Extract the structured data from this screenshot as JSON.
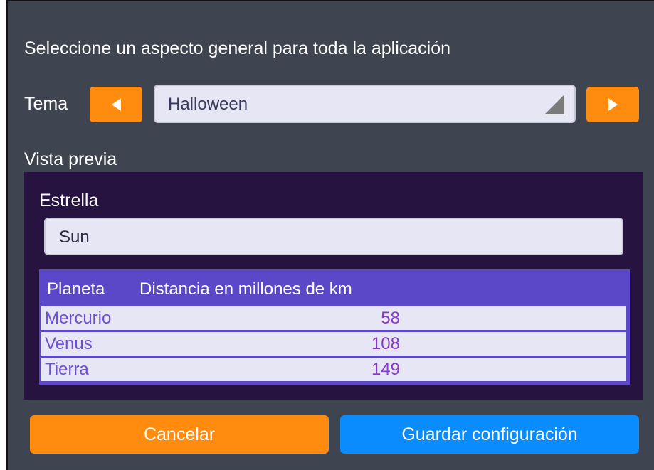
{
  "dialog": {
    "headline": "Seleccione un aspecto general para toda la aplicación"
  },
  "theme": {
    "label": "Tema",
    "selected": "Halloween",
    "prev_icon": "arrow-left-icon",
    "next_icon": "arrow-right-icon"
  },
  "preview": {
    "label": "Vista previa",
    "star_label": "Estrella",
    "star_value": "Sun",
    "table": {
      "columns": [
        "Planeta",
        "Distancia en millones de km"
      ],
      "rows": [
        {
          "planet": "Mercurio",
          "distance": "58"
        },
        {
          "planet": "Venus",
          "distance": "108"
        },
        {
          "planet": "Tierra",
          "distance": "149"
        }
      ]
    }
  },
  "actions": {
    "cancel_label": "Cancelar",
    "save_label": "Guardar configuración"
  },
  "colors": {
    "background": "#3f4550",
    "accent_orange": "#ff8c0f",
    "accent_blue": "#0a8cff",
    "preview_background": "#261340",
    "table_header": "#5a48c9"
  }
}
